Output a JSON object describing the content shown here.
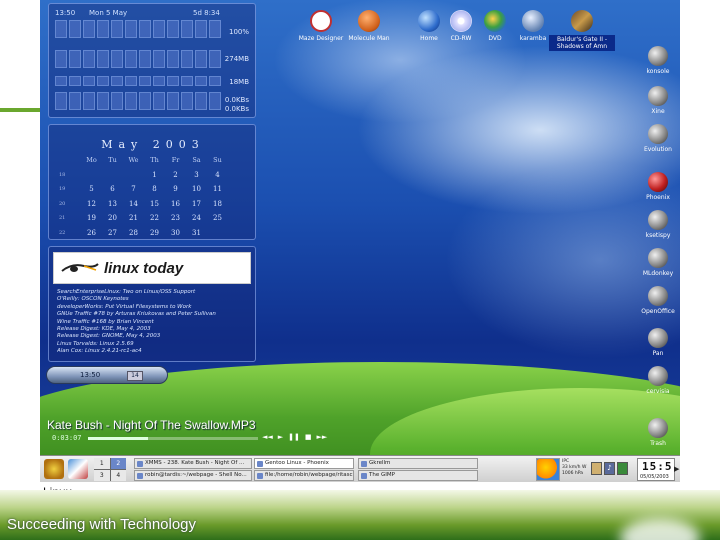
{
  "caption": "Linux",
  "footer_title": "Succeeding with Technology",
  "monitor": {
    "time": "13:50",
    "date": "Mon 5 May",
    "uptime": "5d 8:34",
    "cpu": "100%",
    "mem": "274MB",
    "swap": "18MB",
    "net_in": "0.0KBs",
    "net_out": "0.0KBs"
  },
  "calendar": {
    "month": "May",
    "year": "2003",
    "weekdays": [
      "Mo",
      "Tu",
      "We",
      "Th",
      "Fr",
      "Sa",
      "Su"
    ],
    "weeks": [
      {
        "wk": "18",
        "days": [
          "",
          "",
          "",
          "1",
          "2",
          "3",
          "4"
        ]
      },
      {
        "wk": "19",
        "days": [
          "5",
          "6",
          "7",
          "8",
          "9",
          "10",
          "11"
        ]
      },
      {
        "wk": "20",
        "days": [
          "12",
          "13",
          "14",
          "15",
          "16",
          "17",
          "18"
        ]
      },
      {
        "wk": "21",
        "days": [
          "19",
          "20",
          "21",
          "22",
          "23",
          "24",
          "25"
        ]
      },
      {
        "wk": "22",
        "days": [
          "26",
          "27",
          "28",
          "29",
          "30",
          "31",
          ""
        ]
      }
    ]
  },
  "news": {
    "logo": "linux today",
    "items": [
      "SearchEnterpriseLinux: Two on Linux/OSS Support",
      "O'Reilly: OSCON Keynotes",
      "developerWorks: Put Virtual Filesystems to Work",
      "GNUe Traffic #78 by Arturas Kriukovas and Peter Sullivan",
      "Wine Traffic #168 by Brian Vincent",
      "Release Digest: KDE, May 4, 2003",
      "Release Digest: GNOME, May 4, 2003",
      "Linus Torvalds: Linux 2.5.69",
      "Alan Cox: Linux 2.4.21-rc1-ac4"
    ]
  },
  "clockpill": {
    "time": "13:50",
    "day": "14"
  },
  "player": {
    "title": "Kate Bush - Night Of The Swallow.MP3",
    "elapsed": "0:03:07",
    "progress": 0.35,
    "controls": [
      "◄◄",
      "►",
      "❚❚",
      "■",
      "►►"
    ]
  },
  "desktop_icons": [
    {
      "name": "maze-designer",
      "label": "Maze Designer",
      "icon": "img-maze"
    },
    {
      "name": "molecule-man",
      "label": "Molecule Man",
      "icon": "img-molecule"
    },
    {
      "name": "home",
      "label": "Home",
      "icon": "img-globe"
    },
    {
      "name": "cd-rw",
      "label": "CD-RW",
      "icon": "img-cd"
    },
    {
      "name": "dvd",
      "label": "DVD",
      "icon": "img-dvd"
    },
    {
      "name": "karamba",
      "label": "karamba",
      "icon": "img-karamba"
    },
    {
      "name": "baldurs-gate",
      "label": "Baldur's Gate II - Shadows of Amn",
      "icon": "img-bg2"
    }
  ],
  "right_icons": [
    {
      "name": "konsole",
      "label": "konsole"
    },
    {
      "name": "xine",
      "label": "Xine"
    },
    {
      "name": "evolution",
      "label": "Evolution"
    },
    {
      "name": "phoenix",
      "label": "Phoenix"
    },
    {
      "name": "ksetispy",
      "label": "ksetispy"
    },
    {
      "name": "mldonkey",
      "label": "MLdonkey"
    },
    {
      "name": "openoffice",
      "label": "OpenOffice"
    },
    {
      "name": "pan",
      "label": "Pan"
    },
    {
      "name": "cervisia",
      "label": "cervisia"
    },
    {
      "name": "trash",
      "label": "Trash"
    }
  ],
  "taskbar": {
    "pager": [
      "1",
      "2",
      "3",
      "4"
    ],
    "active_desktop": "2",
    "tasks": [
      {
        "label": "XMMS - 238. Kate Bush - Night Of ...",
        "active": false
      },
      {
        "label": "Gentoo Linux - Phoenix",
        "active": true
      },
      {
        "label": "Gkrellm",
        "active": false
      },
      {
        "label": "robin@tardis:~/webpage - Shell No...",
        "active": false
      },
      {
        "label": "file:/home/robin/webpage/ritascreens",
        "active": false
      },
      {
        "label": "The GIMP",
        "active": false
      }
    ],
    "weather": [
      "IPC",
      "33 km/h W",
      "1006 hPa"
    ],
    "clock_time": "15:5",
    "clock_date": "05/05/2003"
  }
}
